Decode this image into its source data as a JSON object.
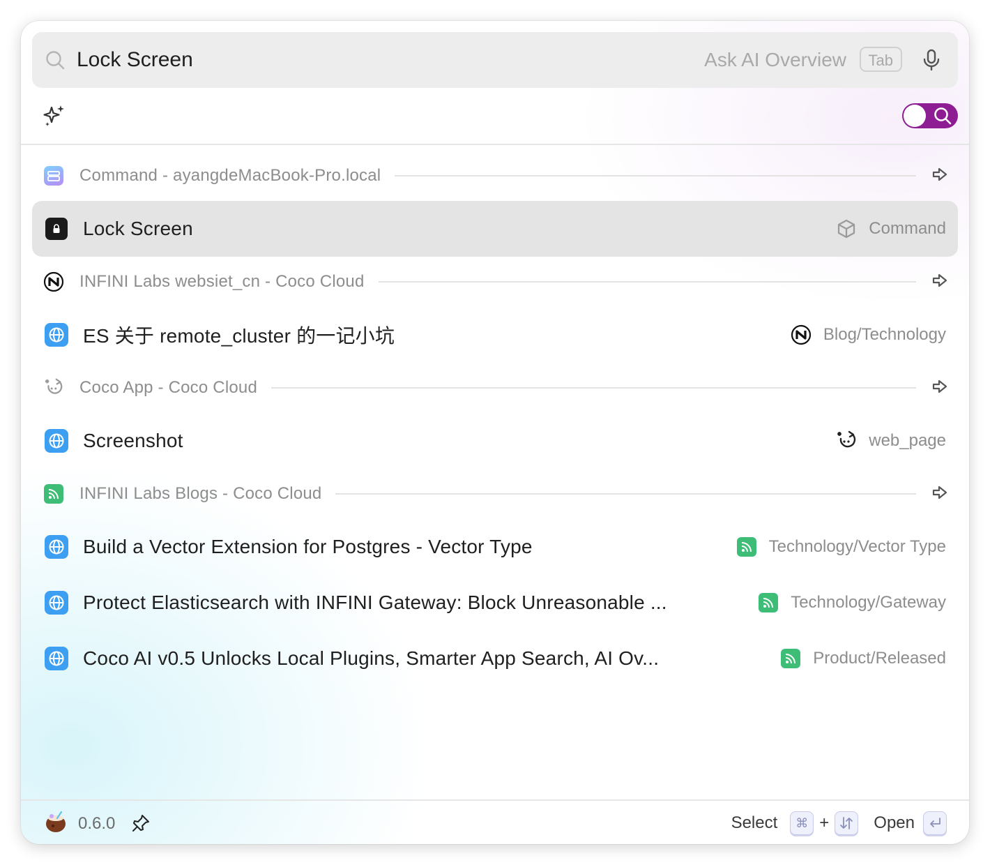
{
  "search": {
    "query": "Lock Screen",
    "ask_ai_label": "Ask AI Overview",
    "tab_key": "Tab"
  },
  "mode_toggle": {
    "state": "search",
    "accent": "#8e1d94"
  },
  "groups": [
    {
      "title": "Command - ayangdeMacBook-Pro.local",
      "icon": "app-folder-icon",
      "items": [
        {
          "title": "Lock Screen",
          "icon": "lock-icon",
          "meta": "Command",
          "meta_icon": "cube-icon",
          "selected": true
        }
      ]
    },
    {
      "title": "INFINI Labs websiet_cn - Coco Cloud",
      "icon": "infini-logo-icon",
      "items": [
        {
          "title": "ES 关于 remote_cluster 的一记小坑",
          "icon": "globe-icon",
          "meta": "Blog/Technology",
          "meta_icon": "infini-logo-icon"
        }
      ]
    },
    {
      "title": "Coco App - Coco Cloud",
      "icon": "coco-app-icon",
      "items": [
        {
          "title": "Screenshot",
          "icon": "globe-icon",
          "meta": "web_page",
          "meta_icon": "coco-app-icon"
        }
      ]
    },
    {
      "title": "INFINI Labs Blogs - Coco Cloud",
      "icon": "rss-icon",
      "items": [
        {
          "title": "Build a Vector Extension for Postgres - Vector Type",
          "icon": "globe-icon",
          "meta": "Technology/Vector Type",
          "meta_icon": "rss-icon"
        },
        {
          "title": "Protect Elasticsearch with INFINI Gateway: Block Unreasonable ...",
          "icon": "globe-icon",
          "meta": "Technology/Gateway",
          "meta_icon": "rss-icon"
        },
        {
          "title": "Coco AI v0.5 Unlocks Local Plugins, Smarter App Search, AI Ov...",
          "icon": "globe-icon",
          "meta": "Product/Released",
          "meta_icon": "rss-icon"
        }
      ]
    }
  ],
  "footer": {
    "version": "0.6.0",
    "select_label": "Select",
    "cmd_key": "⌘",
    "plus": "+",
    "open_label": "Open"
  }
}
